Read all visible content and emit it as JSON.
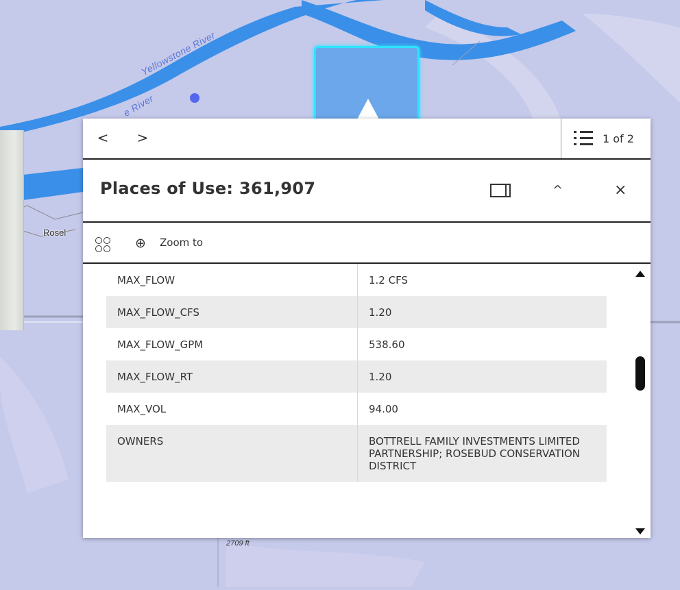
{
  "map": {
    "river_label": "Yellowstone River",
    "river_label_2": "e River",
    "town_label": "Rosel",
    "elevation_label": "2709 ft",
    "river_color": "#3a8fe8",
    "background_color": "#c5c9ea",
    "highlight_color": "#2ee3ff"
  },
  "popup": {
    "nav": {
      "prev_label": "<",
      "next_label": ">"
    },
    "feature_count": "1 of 2",
    "title": "Places of Use: 361,907",
    "controls": {
      "dock_icon": "dock-icon",
      "collapse_label": "^",
      "close_label": "×"
    },
    "actions": {
      "zoom_label": "Zoom to"
    },
    "rows": [
      {
        "key": "MAX_FLOW",
        "value": "1.2 CFS"
      },
      {
        "key": "MAX_FLOW_CFS",
        "value": "1.20"
      },
      {
        "key": "MAX_FLOW_GPM",
        "value": "538.60"
      },
      {
        "key": "MAX_FLOW_RT",
        "value": "1.20"
      },
      {
        "key": "MAX_VOL",
        "value": "94.00"
      },
      {
        "key": "OWNERS",
        "value": "BOTTRELL FAMILY INVESTMENTS LIMITED PARTNERSHIP; ROSEBUD CONSERVATION DISTRICT"
      }
    ]
  }
}
